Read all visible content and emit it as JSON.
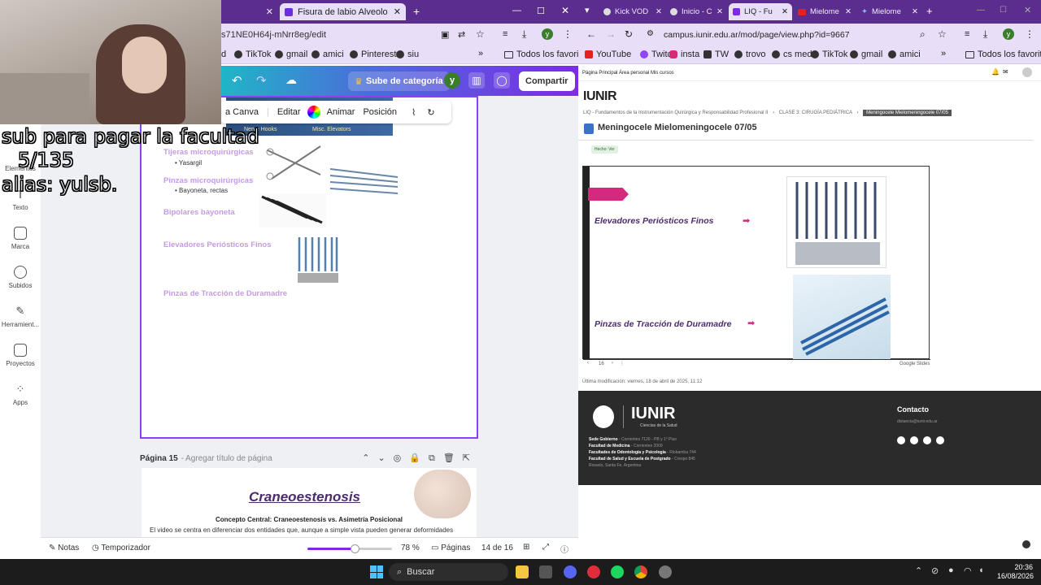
{
  "left_window": {
    "tabs": [
      {
        "label": ""
      },
      {
        "label": "Fisura de labio Alveolo Palatina"
      }
    ],
    "address": "s71NE0H64j-mNrr8eg/edit",
    "bookmarks": [
      "d",
      "TikTok",
      "gmail",
      "amici",
      "Pinterest",
      "siu"
    ],
    "all_bookmarks": "Todos los favoritos",
    "canva": {
      "upload_label": "Sube de categoría",
      "avatar": "y",
      "share_label": "Compartir",
      "toolbar": [
        "a Canva",
        "Editar",
        "Animar",
        "Posición"
      ],
      "sidebar": [
        "Elementos",
        "Texto",
        "Marca",
        "Subidos",
        "Herramient...",
        "Proyectos",
        "Apps"
      ],
      "image_labels": [
        "Nerve Hooks",
        "Misc. Elevators"
      ],
      "items": [
        {
          "title": "Tijeras microquirúrgicas",
          "bullet": "Yasargil"
        },
        {
          "title": "Pinzas microquirúrgicas",
          "bullet": "Bayoneta, rectas"
        },
        {
          "title": "Bipolares bayoneta",
          "bullet": ""
        },
        {
          "title": "Elevadores Periósticos Finos",
          "bullet": ""
        },
        {
          "title": "Pinzas de Tracción de Duramadre",
          "bullet": ""
        }
      ],
      "page15_header": "Página 15",
      "page15_placeholder": "Agregar título de página",
      "page15_title": "Craneoestenosis",
      "page15_subtitle": "Concepto Central: Craneoestenosis vs. Asimetría Posicional",
      "page15_text": "El video se centra en diferenciar dos entidades que, aunque a simple vista pueden generar deformidades",
      "footer": {
        "notes": "Notas",
        "timer": "Temporizador",
        "zoom": "78 %",
        "zoom_fraction": 0.78,
        "pages_label": "Páginas",
        "page_count": "14 de 16"
      }
    }
  },
  "right_window": {
    "tabs": [
      "Kick VOD",
      "Inicio - C",
      "LIQ - Fu",
      "Mielome",
      "Mielome"
    ],
    "address": "campus.iunir.edu.ar/mod/page/view.php?id=9667",
    "bookmarks": [
      "YouTube",
      "Twitch",
      "insta",
      "TW",
      "trovo",
      "cs med",
      "TikTok",
      "gmail",
      "amici"
    ],
    "all_bookmarks": "Todos los favoritos",
    "campus": {
      "nav": [
        "Página Principal",
        "Área personal",
        "Mis cursos"
      ],
      "logo": "IUNIR",
      "crumbs": [
        "LIQ - Fundamentos de la Instrumentación Quirúrgica y Responsabilidad Profesional II",
        "CLASE 3: CIRUGÍA PEDIÁTRICA",
        "Meningocele Mielomeningocele 07/05"
      ],
      "title": "Meningocele Mielomeningocele 07/05",
      "badge": "Hecho: Ver",
      "slide_labels": [
        "Elevadores Periósticos Finos",
        "Pinzas de Tracción de Duramadre"
      ],
      "slide_page": "16",
      "slide_source": "Google Slides",
      "last_modified": "Última modificación: viernes, 18 de abril de 2025, 11:12",
      "footer": {
        "logo": "IUNIR",
        "logo_sub": "Ciencias de la Salud",
        "contact_title": "Contacto",
        "contact_email": "distancia@iunir.edu.ar",
        "sede": [
          {
            "name": "Sede Gobierno",
            "addr": "Corrientes 7120 - PB y 1° Piso"
          },
          {
            "name": "Facultad de Medicina",
            "addr": "Corrientes 2009"
          },
          {
            "name": "Facultades de Odontología y Psicología",
            "addr": "Riobamba 744"
          },
          {
            "name": "Facultad de Salud y Escuela de Postgrado",
            "addr": "Crespo 845"
          }
        ],
        "city": "Rosario, Santa Fe, Argentina"
      }
    }
  },
  "overlay": {
    "line1": "sub para pagar la facultad",
    "line2": "5/135",
    "line3": "alias: yulsb."
  },
  "taskbar": {
    "search": "Buscar",
    "time": "20:36",
    "date": "16/08/2026"
  }
}
